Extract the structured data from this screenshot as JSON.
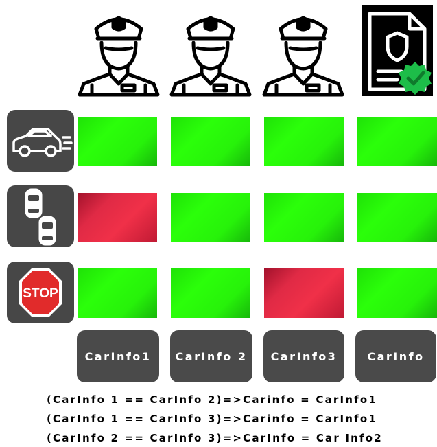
{
  "header_icons": [
    {
      "icon": "police-officer-icon"
    },
    {
      "icon": "police-officer-icon"
    },
    {
      "icon": "police-officer-icon"
    },
    {
      "icon": "verified-document-icon"
    }
  ],
  "row_icons": [
    "speeding-car-icon",
    "overtaking-cars-icon",
    "stop-sign-icon"
  ],
  "stop_sign_text": "STOP",
  "grid": [
    [
      "ok",
      "ok",
      "ok",
      "ok"
    ],
    [
      "bad",
      "ok",
      "ok",
      "ok"
    ],
    [
      "ok",
      "ok",
      "bad",
      "ok"
    ]
  ],
  "colors": {
    "ok": "#2bff0a",
    "bad": "#e02a45",
    "tile": "#474747"
  },
  "buttons": [
    "CarInfo1",
    "CarInfo 2",
    "CarInfo3",
    "CarInfo"
  ],
  "rules": [
    "(CarInfo 1 == CarInfo 2)=>Carinfo = CarInfo1",
    "(CarInfo 1 == CarInfo 3)=>Carinfo = CarInfo1",
    "(CarInfo 2 == CarInfo 3)=>CarInfo = Car Info2"
  ]
}
